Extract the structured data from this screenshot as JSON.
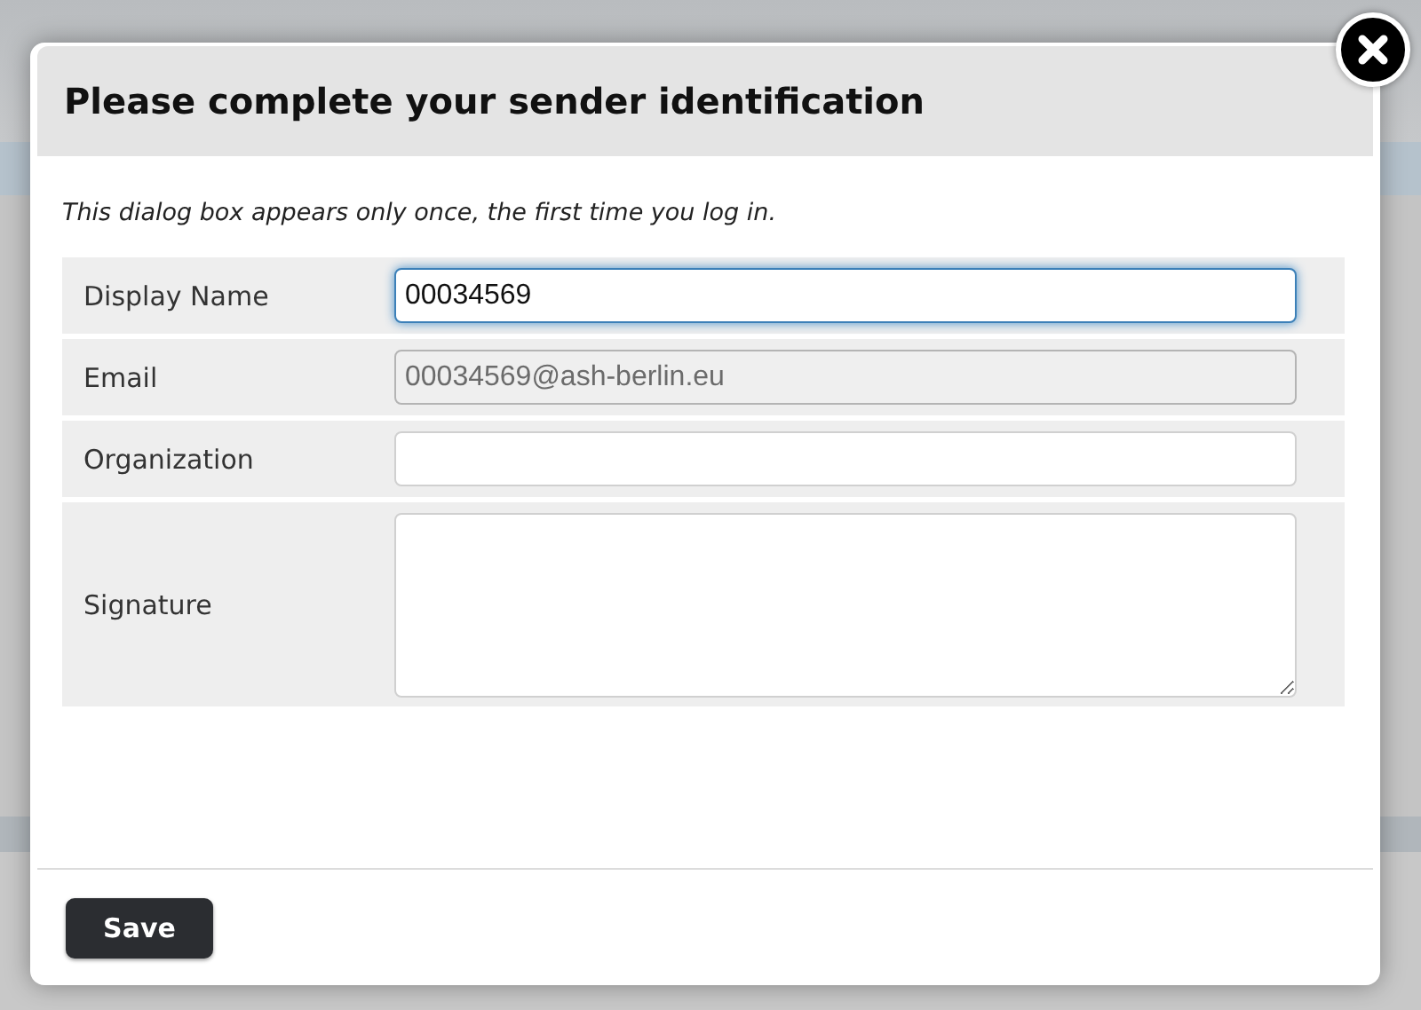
{
  "dialog": {
    "title": "Please complete your sender identification",
    "intro": "This dialog box appears only once, the first time you log in.",
    "fields": [
      {
        "label": "Display Name",
        "kind": "input",
        "value": "00034569",
        "focused": true,
        "disabled": false
      },
      {
        "label": "Email",
        "kind": "input",
        "value": "00034569@ash-berlin.eu",
        "focused": false,
        "disabled": true
      },
      {
        "label": "Organization",
        "kind": "input",
        "focused": false,
        "disabled": false
      },
      {
        "label": "Signature",
        "kind": "textarea",
        "focused": false,
        "disabled": false
      }
    ],
    "buttons": [
      "Save"
    ]
  }
}
